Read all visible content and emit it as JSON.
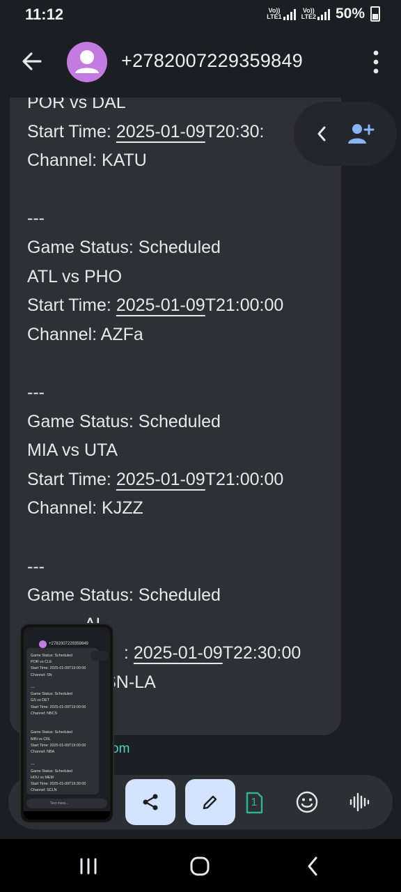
{
  "status_bar": {
    "time": "11:12",
    "sim1_label_top": "Vo))",
    "sim1_label_bottom": "LTE1",
    "sim2_label_top": "Vo))",
    "sim2_label_bottom": "LTE2",
    "battery": "50%"
  },
  "app_bar": {
    "contact": "+2782007229359849",
    "back_icon": "arrow-left-icon",
    "avatar_icon": "person-icon",
    "menu_icon": "more-vert-icon"
  },
  "message": {
    "lines": [
      {
        "prefix": "POR vs DAL",
        "link": "",
        "suffix": ""
      },
      {
        "prefix": "Start Time: ",
        "link": "2025-01-09",
        "suffix": "T20:30:"
      },
      {
        "prefix": "Channel: KATU",
        "link": "",
        "suffix": ""
      },
      {
        "prefix": "",
        "link": "",
        "suffix": ""
      },
      {
        "prefix": "---",
        "link": "",
        "suffix": ""
      },
      {
        "prefix": "Game Status: Scheduled",
        "link": "",
        "suffix": ""
      },
      {
        "prefix": "ATL vs PHO",
        "link": "",
        "suffix": ""
      },
      {
        "prefix": "Start Time: ",
        "link": "2025-01-09",
        "suffix": "T21:00:00"
      },
      {
        "prefix": "Channel: AZFa",
        "link": "",
        "suffix": ""
      },
      {
        "prefix": "",
        "link": "",
        "suffix": ""
      },
      {
        "prefix": "---",
        "link": "",
        "suffix": ""
      },
      {
        "prefix": "Game Status: Scheduled",
        "link": "",
        "suffix": ""
      },
      {
        "prefix": "MIA vs UTA",
        "link": "",
        "suffix": ""
      },
      {
        "prefix": "Start Time: ",
        "link": "2025-01-09",
        "suffix": "T21:00:00"
      },
      {
        "prefix": "Channel: KJZZ",
        "link": "",
        "suffix": ""
      },
      {
        "prefix": "",
        "link": "",
        "suffix": ""
      },
      {
        "prefix": "---",
        "link": "",
        "suffix": ""
      },
      {
        "prefix": "Game Status: Scheduled",
        "link": "",
        "suffix": ""
      },
      {
        "prefix": "            AL",
        "link": "",
        "suffix": ""
      },
      {
        "prefix": "                    : ",
        "link": "2025-01-09",
        "suffix": "T22:30:00"
      },
      {
        "prefix": "                SN-LA",
        "link": "",
        "suffix": ""
      }
    ]
  },
  "link_fragment": "om",
  "floating": {
    "chevron_icon": "chevron-left-icon",
    "add_contact_icon": "person-add-icon"
  },
  "composer": {
    "share_icon": "share-icon",
    "edit_icon": "pencil-icon",
    "sim_number": "1",
    "emoji_icon": "emoji-icon",
    "voice_icon": "voice-waveform-icon"
  },
  "pip": {
    "contact": "+2782007229359849",
    "lines": [
      "Game Status: Scheduled",
      "POR vs CLE",
      "Start Time: 2025-01-09T19:00:00",
      "Channel: SN",
      "",
      "---",
      "Game Status: Scheduled",
      "GS vs DET",
      "Start Time: 2025-01-09T19:00:00",
      "Channel: NBCS",
      "",
      "",
      "Game Status: Scheduled",
      "MIN vs CRL",
      "Start Time: 2025-01-09T19:00:00",
      "Channel: NBA",
      "",
      "---",
      "Game Status: Scheduled",
      "HOU vs MEM",
      "Start Time: 2025-01-09T19:30:00",
      "Channel: SCLN"
    ],
    "composer_placeholder": "Text mess..."
  },
  "colors": {
    "background": "#1b1e22",
    "bubble": "#2e3035",
    "accent_avatar": "#c47be0",
    "button_fill": "#d3e3fd",
    "link_teal": "#4fd1c5"
  }
}
